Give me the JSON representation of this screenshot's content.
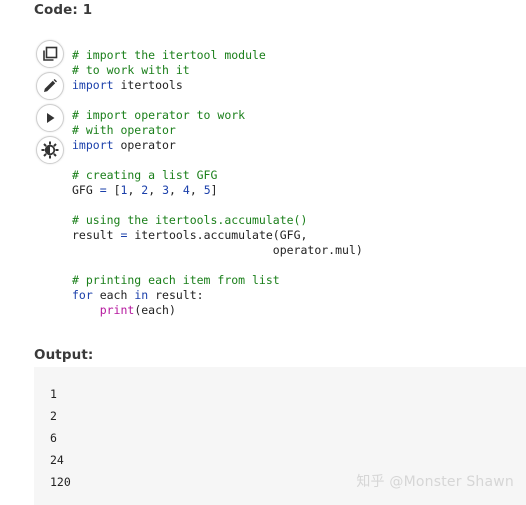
{
  "code_section": {
    "heading": "Code: 1",
    "toolbar": {
      "copy_icon": "copy-icon",
      "edit_icon": "pencil-icon",
      "run_icon": "play-icon",
      "theme_icon": "theme-toggle-icon"
    },
    "lines": [
      [
        {
          "t": "# import the itertool module",
          "c": "cm"
        }
      ],
      [
        {
          "t": "# to work with it",
          "c": "cm"
        }
      ],
      [
        {
          "t": "import",
          "c": "kw"
        },
        {
          "t": " itertools",
          "c": ""
        }
      ],
      [],
      [
        {
          "t": "# import operator to work",
          "c": "cm"
        }
      ],
      [
        {
          "t": "# with operator",
          "c": "cm"
        }
      ],
      [
        {
          "t": "import",
          "c": "kw"
        },
        {
          "t": " operator",
          "c": ""
        }
      ],
      [],
      [
        {
          "t": "# creating a list GFG",
          "c": "cm"
        }
      ],
      [
        {
          "t": "GFG ",
          "c": ""
        },
        {
          "t": "=",
          "c": "kw"
        },
        {
          "t": " [",
          "c": ""
        },
        {
          "t": "1",
          "c": "num"
        },
        {
          "t": ", ",
          "c": ""
        },
        {
          "t": "2",
          "c": "num"
        },
        {
          "t": ", ",
          "c": ""
        },
        {
          "t": "3",
          "c": "num"
        },
        {
          "t": ", ",
          "c": ""
        },
        {
          "t": "4",
          "c": "num"
        },
        {
          "t": ", ",
          "c": ""
        },
        {
          "t": "5",
          "c": "num"
        },
        {
          "t": "]",
          "c": ""
        }
      ],
      [],
      [
        {
          "t": "# using the itertools.accumulate()",
          "c": "cm"
        }
      ],
      [
        {
          "t": "result ",
          "c": ""
        },
        {
          "t": "=",
          "c": "kw"
        },
        {
          "t": " itertools.accumulate(GFG,",
          "c": ""
        }
      ],
      [
        {
          "t": "                             operator.mul)",
          "c": ""
        }
      ],
      [],
      [
        {
          "t": "# printing each item from list",
          "c": "cm"
        }
      ],
      [
        {
          "t": "for",
          "c": "kw"
        },
        {
          "t": " each ",
          "c": ""
        },
        {
          "t": "in",
          "c": "kw"
        },
        {
          "t": " result:",
          "c": ""
        }
      ],
      [
        {
          "t": "    ",
          "c": ""
        },
        {
          "t": "print",
          "c": "fn"
        },
        {
          "t": "(each)",
          "c": ""
        }
      ]
    ]
  },
  "output_section": {
    "heading": "Output:",
    "lines": [
      "1",
      "2",
      "6",
      "24",
      "120"
    ]
  },
  "watermark": "知乎 @Monster Shawn",
  "colors": {
    "comment": "#1a7f1a",
    "keyword": "#1a3faa",
    "builtin": "#b5179e",
    "output_bg": "#f6f6f6"
  }
}
